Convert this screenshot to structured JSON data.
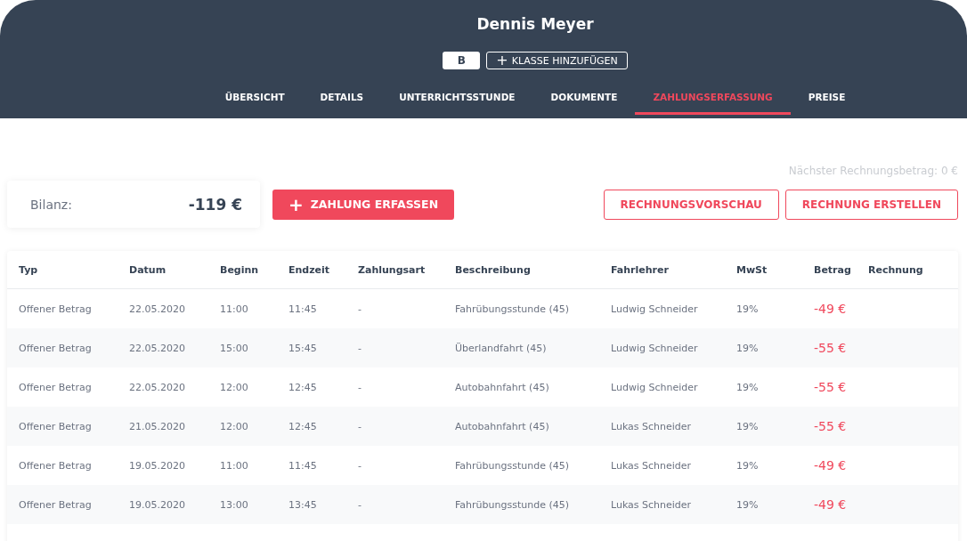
{
  "header": {
    "name": "Dennis Meyer",
    "class_badge": "B",
    "add_class_button": {
      "icon": "+",
      "label": "KLASSE HINZUFÜGEN"
    }
  },
  "tabs": [
    {
      "label": "ÜBERSICHT",
      "selected": false
    },
    {
      "label": "DETAILS",
      "selected": false
    },
    {
      "label": "UNTERRICHTSSTUNDE",
      "selected": false
    },
    {
      "label": "DOKUMENTE",
      "selected": false
    },
    {
      "label": "ZAHLUNGSERFASSUNG",
      "selected": true
    },
    {
      "label": "PREISE",
      "selected": false
    }
  ],
  "next_invoice_amount": "Nächster Rechnungsbetrag: 0 €",
  "balance": {
    "label": "Bilanz:",
    "value": "-119 €"
  },
  "record_payment_button": {
    "icon": "+",
    "label": "ZAHLUNG ERFASSEN"
  },
  "invoice_preview_button": "RECHNUNGSVORSCHAU",
  "create_invoice_button": "RECHNUNG ERSTELLEN",
  "table": {
    "columns": [
      "Typ",
      "Datum",
      "Beginn",
      "Endzeit",
      "Zahlungsart",
      "Beschreibung",
      "Fahrlehrer",
      "MwSt",
      "Betrag",
      "Rechnung"
    ],
    "rows": [
      [
        "Offener Betrag",
        "22.05.2020",
        "11:00",
        "11:45",
        "-",
        "Fahrübungsstunde (45)",
        "Ludwig Schneider",
        "19%",
        "-49 €"
      ],
      [
        "Offener Betrag",
        "22.05.2020",
        "15:00",
        "15:45",
        "-",
        "Überlandfahrt (45)",
        "Ludwig Schneider",
        "19%",
        "-55 €"
      ],
      [
        "Offener Betrag",
        "22.05.2020",
        "12:00",
        "12:45",
        "-",
        "Autobahnfahrt (45)",
        "Ludwig Schneider",
        "19%",
        "-55 €"
      ],
      [
        "Offener Betrag",
        "21.05.2020",
        "12:00",
        "12:45",
        "-",
        "Autobahnfahrt (45)",
        "Lukas Schneider",
        "19%",
        "-55 €"
      ],
      [
        "Offener Betrag",
        "19.05.2020",
        "11:00",
        "11:45",
        "-",
        "Fahrübungsstunde (45)",
        "Lukas Schneider",
        "19%",
        "-49 €"
      ],
      [
        "Offener Betrag",
        "19.05.2020",
        "13:00",
        "13:45",
        "-",
        "Fahrübungsstunde (45)",
        "Lukas Schneider",
        "19%",
        "-49 €"
      ]
    ]
  }
}
